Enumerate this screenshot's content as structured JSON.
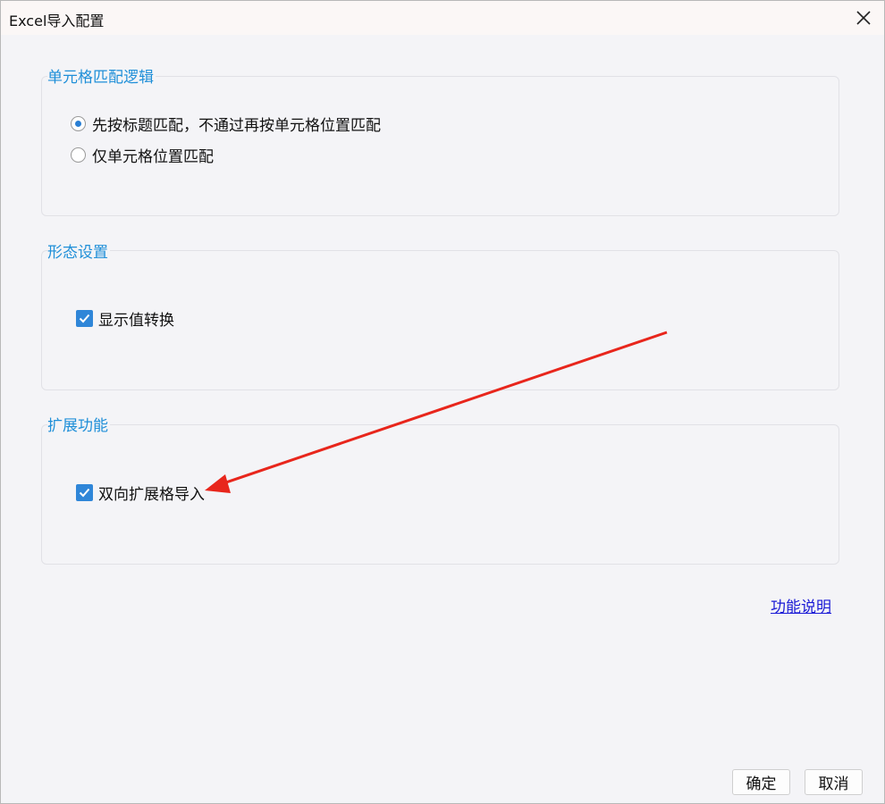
{
  "window": {
    "title": "Excel导入配置"
  },
  "cell_match": {
    "title": "单元格匹配逻辑",
    "options": [
      {
        "label": "先按标题匹配，不通过再按单元格位置匹配",
        "selected": true
      },
      {
        "label": "仅单元格位置匹配",
        "selected": false
      }
    ]
  },
  "form_settings": {
    "title": "形态设置",
    "display_value_convert": {
      "label": "显示值转换",
      "checked": true
    }
  },
  "extensions": {
    "title": "扩展功能",
    "bidirectional_import": {
      "label": "双向扩展格导入",
      "checked": true
    }
  },
  "help_link": "功能说明",
  "buttons": {
    "ok": "确定",
    "cancel": "取消"
  },
  "colors": {
    "group_title": "#1f8fd8",
    "checkbox": "#2f86d8",
    "link": "#1a1ad6",
    "arrow": "#e8261c"
  }
}
